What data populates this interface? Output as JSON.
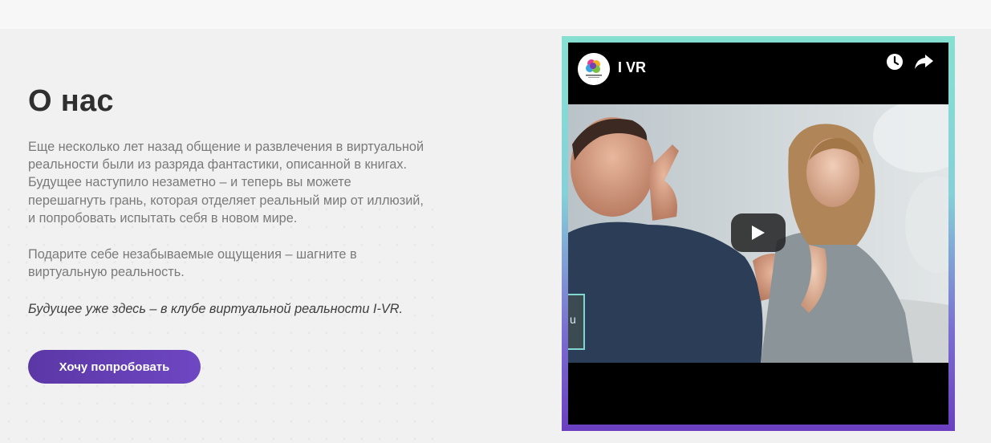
{
  "about": {
    "title": "О нас",
    "paragraph1": "Еще несколько лет назад общение и развлечения в виртуальной реальности были из разряда фантастики, описанной в книгах. Будущее наступило незаметно – и теперь вы можете перешагнуть грань, которая отделяет реальный мир от иллюзий, и попробовать испытать себя в новом мире.",
    "paragraph2": "Подарите себе незабываемые ощущения – шагните в виртуальную реальность.",
    "tagline": "Будущее уже здесь – в клубе виртуальной реальности I-VR.",
    "cta_label": "Хочу попробовать"
  },
  "video": {
    "channel_name": "I VR",
    "channel_logo_icon": "ivr-logo-icon",
    "watch_later_icon": "clock-icon",
    "share_icon": "share-arrow-icon",
    "play_icon": "play-icon",
    "sign_letter": "u"
  },
  "colors": {
    "button_purple": "#5b37a6",
    "frame_teal": "#86e0d2",
    "frame_purple": "#6a3fc0"
  }
}
